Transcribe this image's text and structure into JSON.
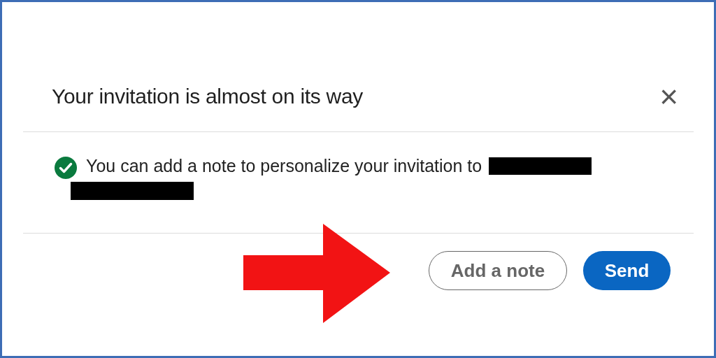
{
  "dialog": {
    "title": "Your invitation is almost on its way",
    "close": "×",
    "message": {
      "text": "You can add a note to personalize your invitation to",
      "redacted": true
    },
    "buttons": [
      {
        "label": "Add a note",
        "kind": "secondary"
      },
      {
        "label": "Send",
        "kind": "primary"
      }
    ]
  },
  "annotation": {
    "kind": "arrow",
    "color": "#f21314"
  }
}
